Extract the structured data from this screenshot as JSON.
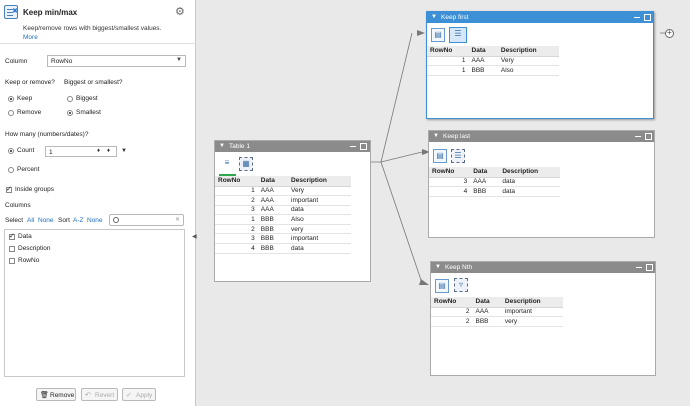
{
  "panel": {
    "title": "Keep min/max",
    "description": "Keep/remove rows with biggest/smallest values.",
    "more": "More",
    "column_label": "Column",
    "column_value": "RowNo",
    "keep_remove_label": "Keep or remove?",
    "keep_label": "Keep",
    "remove_label": "Remove",
    "biggest_smallest_label": "Biggest or smallest?",
    "biggest_label": "Biggest",
    "smallest_label": "Smallest",
    "how_many_label": "How many (numbers/dates)?",
    "count_label": "Count",
    "count_value": "1",
    "percent_label": "Percent",
    "inside_groups_label": "Inside groups",
    "inside_groups_checked": true,
    "columns_label": "Columns",
    "select_label": "Select",
    "all_label": "All",
    "none_label": "None",
    "sort_label": "Sort",
    "az_label": "A-Z",
    "sort_none_label": "None",
    "columns": [
      {
        "name": "Data",
        "checked": true
      },
      {
        "name": "Description",
        "checked": false
      },
      {
        "name": "RowNo",
        "checked": false
      }
    ],
    "remove_button": "Remove",
    "revert_button": "Revert",
    "apply_button": "Apply"
  },
  "nodes": {
    "table1": {
      "title": "Table 1",
      "headers": [
        "RowNo",
        "Data",
        "Description"
      ],
      "rows": [
        [
          "1",
          "AAA",
          "Very"
        ],
        [
          "2",
          "AAA",
          "important"
        ],
        [
          "3",
          "AAA",
          "data"
        ],
        [
          "1",
          "BBB",
          "Also"
        ],
        [
          "2",
          "BBB",
          "very"
        ],
        [
          "3",
          "BBB",
          "important"
        ],
        [
          "4",
          "BBB",
          "data"
        ]
      ]
    },
    "keep_first": {
      "title": "Keep first",
      "headers": [
        "RowNo",
        "Data",
        "Description"
      ],
      "rows": [
        [
          "1",
          "AAA",
          "Very"
        ],
        [
          "1",
          "BBB",
          "Also"
        ]
      ]
    },
    "keep_last": {
      "title": "Keep last",
      "headers": [
        "RowNo",
        "Data",
        "Description"
      ],
      "rows": [
        [
          "3",
          "AAA",
          "data"
        ],
        [
          "4",
          "BBB",
          "data"
        ]
      ]
    },
    "keep_nth": {
      "title": "Keep Nth",
      "headers": [
        "RowNo",
        "Data",
        "Description"
      ],
      "rows": [
        [
          "2",
          "AAA",
          "important"
        ],
        [
          "2",
          "BBB",
          "very"
        ]
      ]
    }
  },
  "colors": {
    "selected_header": "#3d8fd6",
    "node_header": "#8b8b8b",
    "link": "#1f6fc0",
    "accent_green": "#2fa84f"
  }
}
